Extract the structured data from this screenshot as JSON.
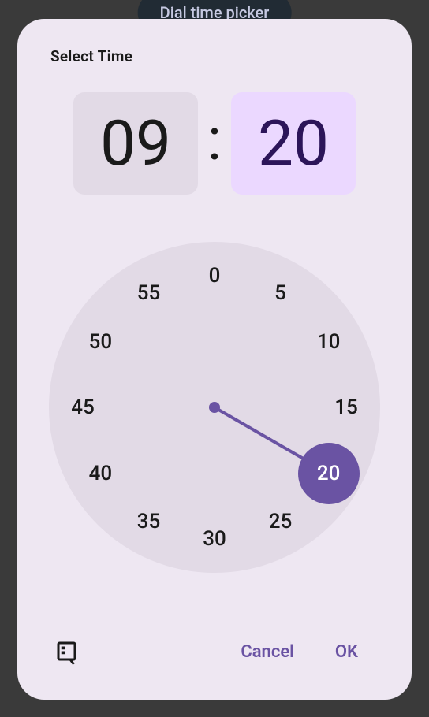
{
  "background_button": "Dial time picker",
  "modal": {
    "title": "Select Time",
    "hours": "09",
    "minutes": "20",
    "colon": ":",
    "active_field": "minutes",
    "selected_value": 20,
    "ticks": [
      0,
      5,
      10,
      15,
      20,
      25,
      30,
      35,
      40,
      45,
      50,
      55
    ],
    "cancel": "Cancel",
    "ok": "OK"
  },
  "colors": {
    "accent": "#6a53a3",
    "modal_bg": "#eee7f2",
    "face_bg": "#e2dae6",
    "minutes_bg": "#ebd8ff"
  }
}
